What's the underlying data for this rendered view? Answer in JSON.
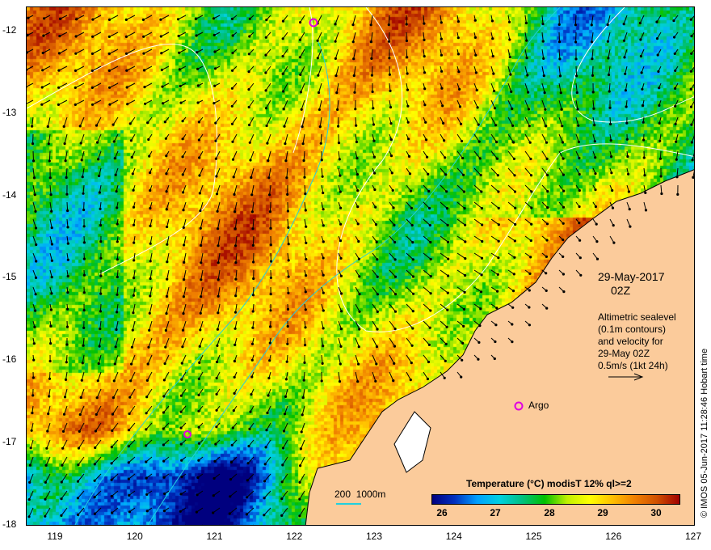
{
  "map": {
    "x_ticks": [
      "119",
      "120",
      "121",
      "122",
      "123",
      "124",
      "125",
      "126",
      "127"
    ],
    "y_ticks": [
      "-12",
      "-13",
      "-14",
      "-15",
      "-16",
      "-17",
      "-18"
    ],
    "date": "29-May-2017",
    "time": "02Z",
    "description": [
      "Altimetric sealevel",
      "(0.1m contours)",
      "and velocity for",
      "29-May 02Z",
      "0.5m/s (1kt 24h)"
    ],
    "argo_label": "Argo",
    "isobath_label": "200  1000m",
    "colorbar": {
      "title": "Temperature (°C) modisT 12% ql>=2",
      "labels": [
        "26",
        "27",
        "28",
        "29",
        "30"
      ]
    },
    "credit": "© IMOS 05-Jun-2017 11:28:46 Hobart time",
    "colors": {
      "land": "#fbcb9b",
      "argo": "#e000e0",
      "isobath": "#20d0e0",
      "contour": "#ffffff",
      "arrow": "#000000"
    }
  }
}
